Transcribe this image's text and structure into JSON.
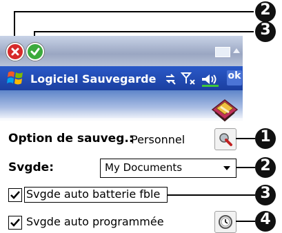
{
  "nav": {
    "title": "Logiciel Sauvegarde",
    "ok_label": "ok"
  },
  "form": {
    "option_label": "Option de sauveg.:",
    "option_value": "Personnel",
    "svgde_label": "Svgde:",
    "svgde_selected": "My Documents",
    "checkbox_low_battery_label": "Svgde auto batterie fble",
    "checkbox_scheduled_label": "Svgde auto programmée",
    "checkbox_low_battery_checked": true,
    "checkbox_scheduled_checked": true
  },
  "callouts": [
    "2",
    "3",
    "1",
    "2",
    "3",
    "4"
  ],
  "colors": {
    "navbar": "#1f47b0",
    "close_button": "#d62a2a",
    "ok_check_button": "#3caa3c"
  },
  "icons": {
    "close": "close-icon",
    "confirm": "check-icon",
    "keyboard": "keyboard-icon",
    "start": "windows-flag-icon",
    "connectivity": "connectivity-icon",
    "signal": "signal-icon",
    "volume": "volume-icon",
    "app": "backup-app-icon",
    "options": "options-icon",
    "schedule": "clock-icon"
  }
}
